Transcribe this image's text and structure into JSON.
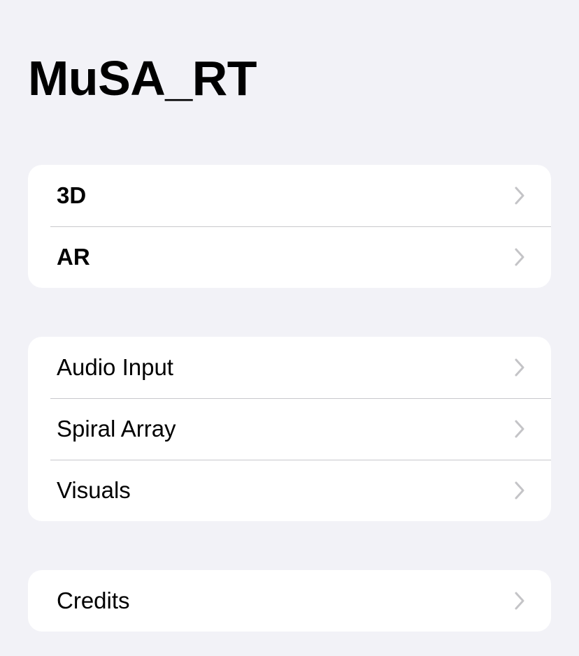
{
  "app": {
    "title": "MuSA_RT"
  },
  "groups": [
    {
      "rows": [
        {
          "label": "3D",
          "icon": "chevron-right-icon"
        },
        {
          "label": "AR",
          "icon": "chevron-right-icon"
        }
      ]
    },
    {
      "rows": [
        {
          "label": "Audio Input",
          "icon": "chevron-right-icon"
        },
        {
          "label": "Spiral Array",
          "icon": "chevron-right-icon"
        },
        {
          "label": "Visuals",
          "icon": "chevron-right-icon"
        }
      ]
    },
    {
      "rows": [
        {
          "label": "Credits",
          "icon": "chevron-right-icon"
        }
      ]
    }
  ],
  "colors": {
    "background": "#F2F2F7",
    "cell_background": "#FFFFFF",
    "separator": "#C8C8CC",
    "chevron": "#C4C4C7",
    "text": "#000000"
  }
}
